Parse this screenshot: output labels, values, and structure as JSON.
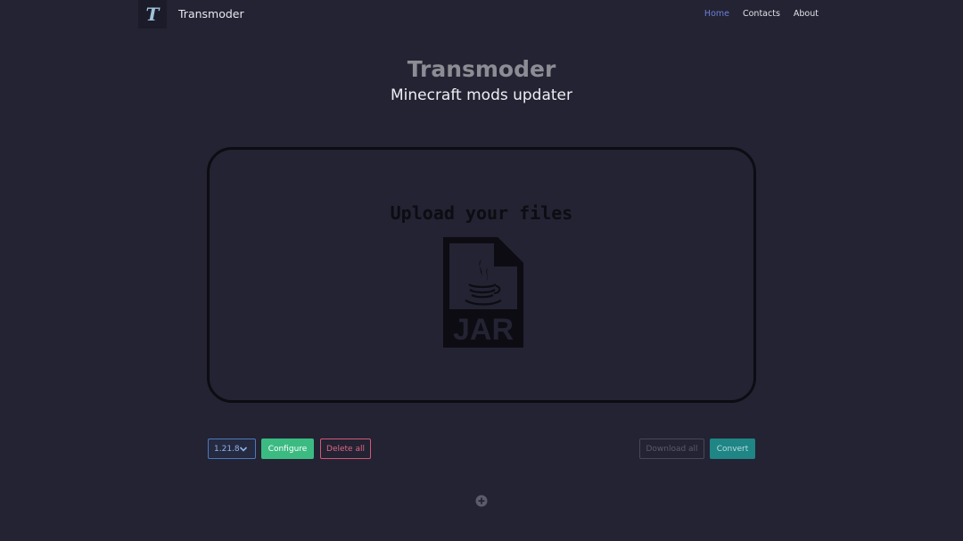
{
  "navbar": {
    "logo_letter": "T",
    "brand": "Transmoder",
    "links": [
      {
        "label": "Home",
        "active": true
      },
      {
        "label": "Contacts",
        "active": false
      },
      {
        "label": "About",
        "active": false
      }
    ]
  },
  "hero": {
    "title": "Transmoder",
    "subtitle": "Minecraft mods updater"
  },
  "dropzone": {
    "prompt": "Upload your files",
    "icon": "jar-file-icon",
    "icon_text": "JAR"
  },
  "controls": {
    "version_selected": "1.21.8",
    "configure_label": "Configure",
    "delete_label": "Delete all",
    "download_label": "Download all",
    "convert_label": "Convert"
  },
  "colors": {
    "background": "#232333",
    "accent_link": "#6b7fd8",
    "configure": "#3bbb82",
    "delete": "#d35777",
    "convert": "#1f8585"
  }
}
